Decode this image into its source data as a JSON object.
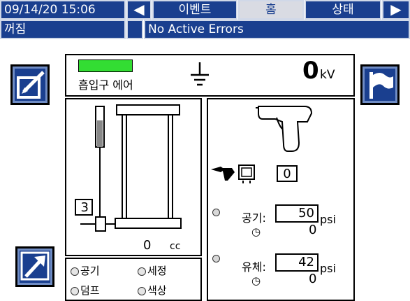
{
  "header": {
    "datetime": "09/14/20 15:06",
    "left_arrow": "◀",
    "right_arrow": "▶",
    "tabs": [
      {
        "label": "이벤트",
        "selected": false
      },
      {
        "label": "홈",
        "selected": true
      },
      {
        "label": "상태",
        "selected": false
      }
    ]
  },
  "status": {
    "mode": "꺼짐",
    "message": "No Active Errors"
  },
  "top_panel": {
    "inlet_air_label": "흡입구 에어",
    "inlet_air_color": "#33dd33",
    "voltage_value": "0",
    "voltage_unit": "kV"
  },
  "pump_panel": {
    "stroke_number": "3",
    "volume_value": "0",
    "volume_unit": "cc"
  },
  "gun_panel": {
    "gun_count": "0",
    "air": {
      "label": "공기:",
      "setpoint": "50",
      "actual": "0",
      "unit": "psi"
    },
    "fluid": {
      "label": "유체:",
      "setpoint": "42",
      "actual": "0",
      "unit": "psi"
    }
  },
  "mode_panel": {
    "options": [
      "공기",
      "세정",
      "덤프",
      "색상"
    ]
  },
  "colors": {
    "bar_blue": "#1a3f8f",
    "selected_tab": "#d9dbe3",
    "indicator_green": "#33dd33"
  }
}
